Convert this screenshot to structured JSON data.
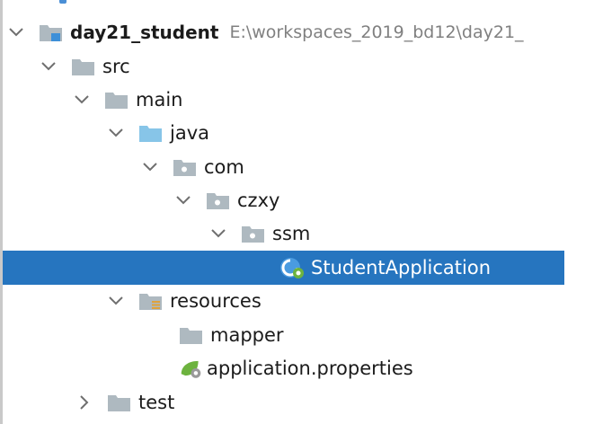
{
  "tree": {
    "project": {
      "name": "day21_student",
      "path": "E:\\workspaces_2019_bd12\\day21_"
    },
    "nodes": [
      {
        "label": "src",
        "icon": "folder-icon",
        "expanded": true
      },
      {
        "label": "main",
        "icon": "folder-icon",
        "expanded": true
      },
      {
        "label": "java",
        "icon": "source-root-folder-icon",
        "expanded": true
      },
      {
        "label": "com",
        "icon": "package-icon",
        "expanded": true
      },
      {
        "label": "czxy",
        "icon": "package-icon",
        "expanded": true
      },
      {
        "label": "ssm",
        "icon": "package-icon",
        "expanded": true
      },
      {
        "label": "StudentApplication",
        "icon": "spring-boot-class-icon",
        "selected": true
      },
      {
        "label": "resources",
        "icon": "resources-folder-icon",
        "expanded": true
      },
      {
        "label": "mapper",
        "icon": "folder-icon"
      },
      {
        "label": "application.properties",
        "icon": "spring-properties-icon"
      },
      {
        "label": "test",
        "icon": "folder-icon",
        "expanded": false
      }
    ]
  },
  "colors": {
    "selection": "#2675bf",
    "folder": "#aeb9c0",
    "source_folder": "#87c5e8",
    "module_accent": "#3d8fd8",
    "spring_green": "#6db33f"
  }
}
